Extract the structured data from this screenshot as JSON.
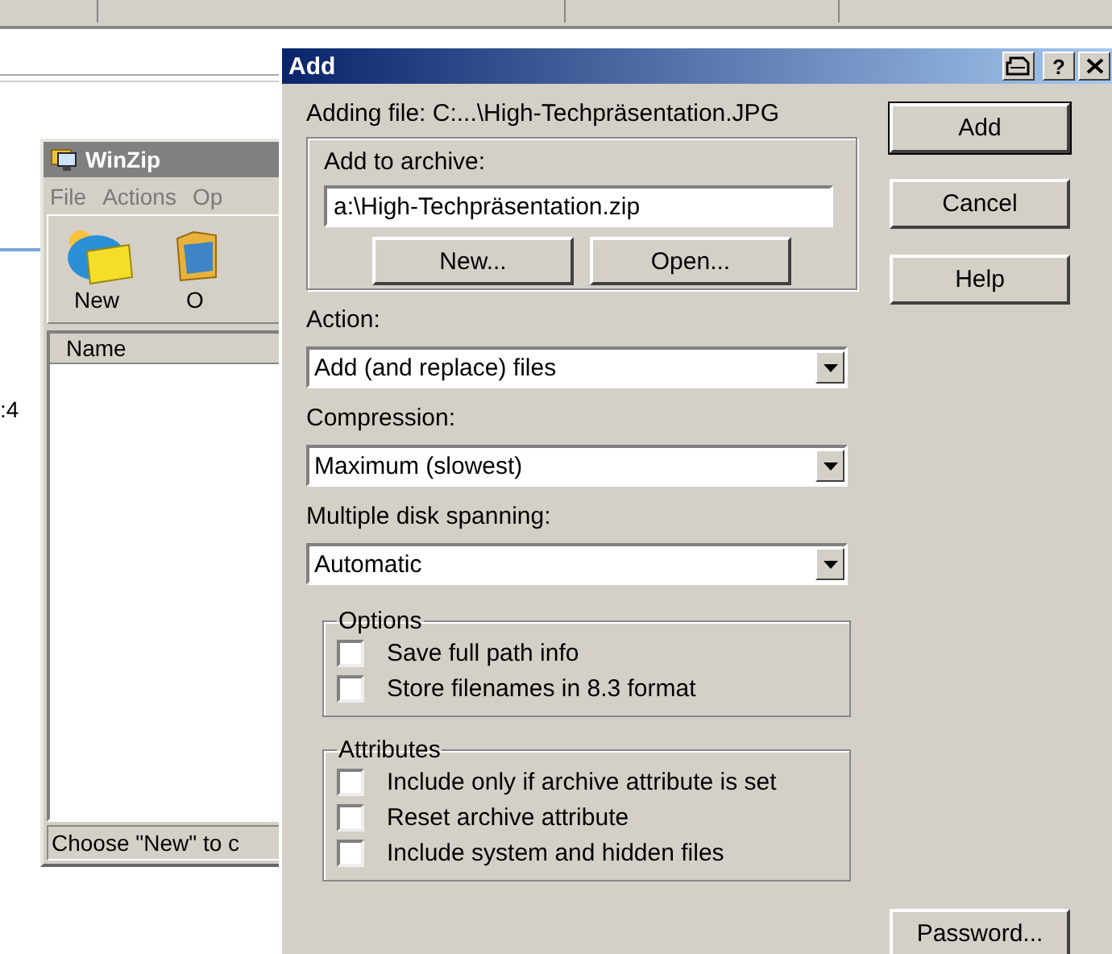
{
  "background": {
    "fragment": ":4"
  },
  "winzip": {
    "title": "WinZip",
    "menu": [
      "File",
      "Actions",
      "Op"
    ],
    "toolbar": [
      {
        "label": "New",
        "kind": "new"
      },
      {
        "label": "O",
        "kind": "open"
      }
    ],
    "list": {
      "columns": [
        "Name"
      ]
    },
    "status_bar": "Choose \"New\" to c"
  },
  "dialog": {
    "title": "Add",
    "help_glyph": "?",
    "adding_file": "Adding file: C:...\\High-Techpräsentation.JPG",
    "archive": {
      "label": "Add to archive:",
      "value": "a:\\High-Techpräsentation.zip",
      "buttons": [
        "New...",
        "Open..."
      ]
    },
    "dropdowns": [
      {
        "label": "Action:",
        "value": "Add (and replace) files"
      },
      {
        "label": "Compression:",
        "value": "Maximum (slowest)"
      },
      {
        "label": "Multiple disk spanning:",
        "value": "Automatic"
      }
    ],
    "groups": [
      {
        "title": "Options",
        "items": [
          {
            "label": "Save full path info",
            "checked": false
          },
          {
            "label": "Store filenames in 8.3 format",
            "checked": false
          }
        ]
      },
      {
        "title": "Attributes",
        "items": [
          {
            "label": "Include only if archive attribute is set",
            "checked": false
          },
          {
            "label": "Reset archive attribute",
            "checked": false
          },
          {
            "label": "Include system and hidden files",
            "checked": false
          }
        ]
      }
    ],
    "buttons": [
      {
        "label": "Add",
        "default": true
      },
      {
        "label": "Cancel",
        "default": false
      },
      {
        "label": "Help",
        "default": false
      }
    ],
    "password_button": "Password..."
  }
}
